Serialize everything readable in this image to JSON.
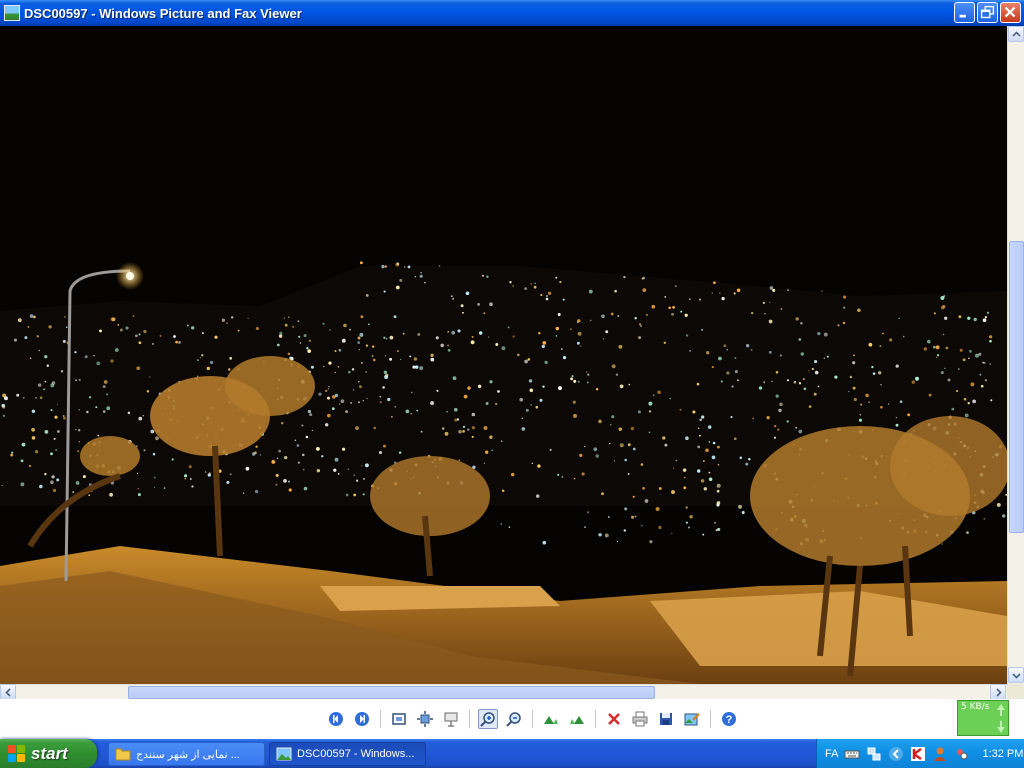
{
  "window": {
    "title": "DSC00597 - Windows Picture and Fax Viewer"
  },
  "toolbar": {
    "tools": [
      "previous-image-icon",
      "next-image-icon",
      "best-fit-icon",
      "actual-size-icon",
      "slideshow-icon",
      "zoom-in-icon",
      "zoom-out-icon",
      "rotate-clockwise-icon",
      "rotate-counterclockwise-icon",
      "delete-icon",
      "print-icon",
      "save-icon",
      "edit-icon",
      "help-icon"
    ]
  },
  "netmeter": {
    "label": "5 KB/s"
  },
  "taskbar": {
    "start_label": "start",
    "tasks": [
      {
        "label": "نمایی از شهر سنندج ...",
        "icon": "folder-icon"
      },
      {
        "label": "DSC00597 - Windows...",
        "icon": "picture-viewer-icon"
      }
    ],
    "language": "FA",
    "clock": "1:32 PM"
  },
  "colors": {
    "titlebar": "#0054e3",
    "taskbar": "#245edb",
    "start": "#3c9d3c",
    "tray": "#0d8ee4"
  }
}
